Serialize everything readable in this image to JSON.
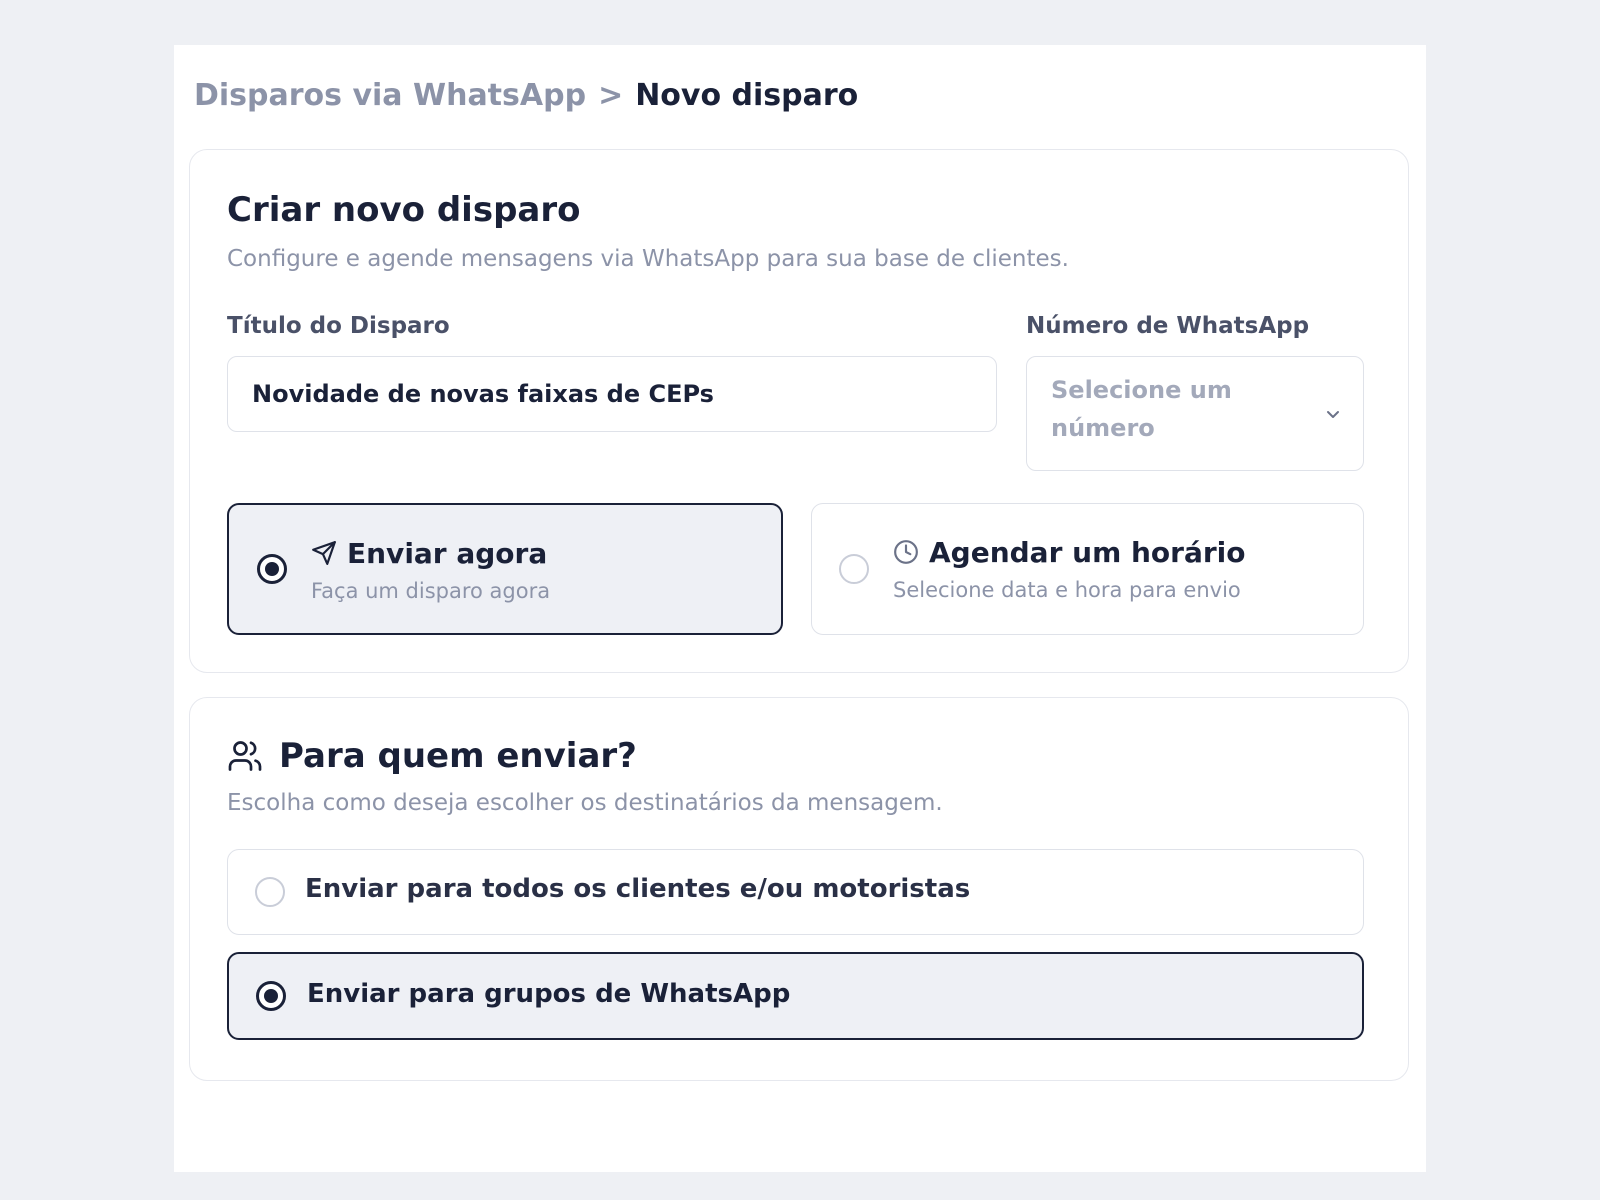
{
  "breadcrumb": {
    "parent": "Disparos via WhatsApp",
    "separator": ">",
    "current": "Novo disparo"
  },
  "create_card": {
    "title": "Criar novo disparo",
    "description": "Configure e agende mensagens via WhatsApp para sua base de clientes.",
    "title_field": {
      "label": "Título do Disparo",
      "value": "Novidade de novas faixas de CEPs"
    },
    "number_field": {
      "label": "Número de WhatsApp",
      "placeholder": "Selecione um número",
      "icon": "chevron-down-icon"
    },
    "send_options": [
      {
        "title": "Enviar agora",
        "subtitle": "Faça um disparo agora",
        "icon": "send-icon",
        "selected": true
      },
      {
        "title": "Agendar um horário",
        "subtitle": "Selecione data e hora para envio",
        "icon": "clock-icon",
        "selected": false
      }
    ]
  },
  "recipients_card": {
    "icon": "users-icon",
    "title": "Para quem enviar?",
    "description": "Escolha como deseja escolher os destinatários da mensagem.",
    "options": [
      {
        "label": "Enviar para todos os clientes e/ou motoristas",
        "selected": false
      },
      {
        "label": "Enviar para grupos de WhatsApp",
        "selected": true
      }
    ]
  },
  "colors": {
    "page_background": "#eef0f4",
    "primary_text": "#1a2138",
    "muted_text": "#8c93a8",
    "selected_background": "#eef0f5",
    "border": "#dfe2e9"
  }
}
